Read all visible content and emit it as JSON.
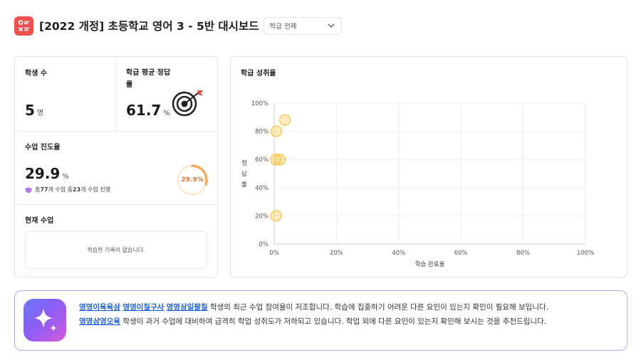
{
  "header": {
    "title": "[2022 개정] 초등학교 영어 3 - 5반 대시보드",
    "filter_value": "학급 전체"
  },
  "stats": {
    "students": {
      "label": "학생 수",
      "value": "5",
      "unit": "명"
    },
    "avg_accuracy": {
      "label_line1": "학급 평균 정답",
      "label_line2": "률",
      "value": "61.7",
      "unit": "%"
    },
    "progress": {
      "label": "수업 진도율",
      "value": "29.9",
      "unit": "%",
      "gauge_text": "29.9%",
      "fraction": 0.299,
      "desc_pre": "총 ",
      "total": "77",
      "desc_mid": "개 수업 중 ",
      "done": "23",
      "desc_post": "개 수업 진행"
    },
    "current_class": {
      "label": "현재 수업",
      "empty_text": "학습한 기록이 없습니다."
    }
  },
  "chart_data": {
    "type": "scatter",
    "title": "학급 성취율",
    "xlabel": "학습 완료율",
    "ylabel": "정답률",
    "xlim": [
      0,
      100
    ],
    "ylim": [
      0,
      100
    ],
    "x_ticks": [
      "0%",
      "20%",
      "40%",
      "60%",
      "80%",
      "100%"
    ],
    "y_ticks": [
      "0%",
      "20%",
      "40%",
      "60%",
      "80%",
      "100%"
    ],
    "grid": true,
    "points": [
      {
        "x": 3.5,
        "y": 88
      },
      {
        "x": 0.7,
        "y": 80
      },
      {
        "x": 0.5,
        "y": 60
      },
      {
        "x": 1.8,
        "y": 60
      },
      {
        "x": 0.6,
        "y": 20
      }
    ],
    "point_color": "#f6c744"
  },
  "ai_message": {
    "line1_names": [
      "영영이육육삼",
      "영영이칠구사",
      "영영삼일팔칠"
    ],
    "line1_text": "학생의 최근 수업 참여율이 저조합니다. 학습에 집중하기 어려운 다른 요인이 있는지 확인이 필요해 보입니다.",
    "line2_names": [
      "영영삼영오육"
    ],
    "line2_text": "학생이 과거 수업에 대비하여 급격히 학업 성취도가 저하되고 있습니다. 학업 외에 다른 요인이 있는지 확인해 보시는 것을 추천드립니다."
  },
  "colors": {
    "logo": "#f24f4f",
    "gauge": "#f5a95a",
    "gauge_text": "#e0742c",
    "link": "#1b5fd6",
    "ai_border": "#b9a7f0"
  }
}
